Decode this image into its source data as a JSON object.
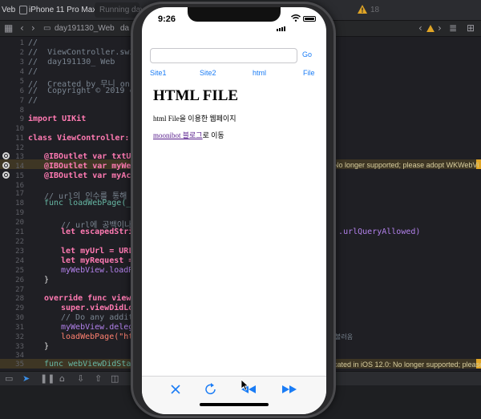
{
  "xcode": {
    "toolbar": {
      "scheme_fragment": "Veb",
      "device": "iPhone 11 Pro Max",
      "run_status": "Running day1",
      "warning_count": "18"
    },
    "jumpbar": {
      "project": "day191130_Web",
      "folder": "da"
    },
    "editor": {
      "line_numbers": [
        "1",
        "2",
        "3",
        "4",
        "5",
        "6",
        "7",
        "8",
        "9",
        "10",
        "11",
        "12",
        "13",
        "14",
        "15",
        "16",
        "17",
        "18",
        "19",
        "20",
        "21",
        "22",
        "23",
        "24",
        "25",
        "26",
        "27",
        "28",
        "29",
        "30",
        "31",
        "32",
        "33",
        "34",
        "35"
      ],
      "header_comments": [
        "//",
        "//  ViewController.swift",
        "//  day191130_ Web",
        "//",
        "//  Created by 무니 on 02/1",
        "//  Copyright © 2019 com.",
        "//"
      ],
      "import_line": "import UIKit",
      "class_line": "class ViewController: UIV",
      "outlet_1": "@IBOutlet var txtUrl:",
      "outlet_2": "@IBOutlet var myWebVi",
      "outlet_3": "@IBOutlet var myActiv",
      "comment_url": "// url의 인수를 통해 웹 페",
      "func_load": "func loadWebPage(_ ur",
      "comment_space": "// url에 공백이나 한글",
      "let_escaped": "let escapedString",
      "escaped_tail": "s: .urlQueryAllowed)",
      "let_myurl": "let myUrl = URL(s",
      "let_myrequest": "let myRequest = U",
      "load_req": "myWebView.loadReq",
      "close_brace_1": "}",
      "override_line": "override func viewDid",
      "super_line": "super.viewDidLoad",
      "comment_do": "// Do any additio",
      "delegate_line": "myWebView.delegat",
      "loadwebpage_call": "loadWebPage(\"http",
      "call_comment_tail": "불러옴",
      "close_brace_2": "}",
      "func_start": "func webViewDidStartL",
      "warning_1": "No longer supported; please adopt WKWebVi",
      "warning_2": "cated in iOS 12.0: No longer supported; please..."
    }
  },
  "simulator": {
    "status_time": "9:26",
    "url_input": {
      "value": "",
      "placeholder": ""
    },
    "go_label": "Go",
    "site_buttons": [
      "Site1",
      "Site2",
      "html",
      "File"
    ],
    "web_content": {
      "heading": "HTML FILE",
      "paragraph": "html File을 이용한 웹페이지",
      "link_text": "moonibot 블로그",
      "link_suffix": "로 이동"
    },
    "toolbar_icons": [
      "stop-icon",
      "refresh-icon",
      "rewind-icon",
      "fast-forward-icon"
    ],
    "accent_color": "#1a7cf5"
  }
}
